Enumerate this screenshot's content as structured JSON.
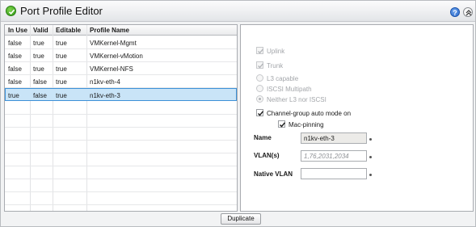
{
  "window": {
    "title": "Port Profile Editor"
  },
  "header_buttons": {
    "help_label": "?"
  },
  "table": {
    "columns": [
      "In Use",
      "Valid",
      "Editable",
      "Profile Name"
    ],
    "rows": [
      {
        "in_use": "false",
        "valid": "true",
        "editable": "true",
        "name": "VMKernel-Mgmt"
      },
      {
        "in_use": "false",
        "valid": "true",
        "editable": "true",
        "name": "VMKernel-vMotion"
      },
      {
        "in_use": "false",
        "valid": "true",
        "editable": "true",
        "name": "VMKernel-NFS"
      },
      {
        "in_use": "false",
        "valid": "false",
        "editable": "true",
        "name": "n1kv-eth-4"
      },
      {
        "in_use": "true",
        "valid": "false",
        "editable": "true",
        "name": "n1kv-eth-3"
      }
    ],
    "selected_row": 4
  },
  "form": {
    "uplink_label": "Uplink",
    "trunk_label": "Trunk",
    "l3_label": "L3 capable",
    "iscsi_label": "ISCSI Multipath",
    "neither_label": "Neither L3 nor ISCSI",
    "channel_group_label": "Channel-group auto mode on",
    "mac_pinning_label": "Mac-pinning",
    "name_label": "Name",
    "name_value": "n1kv-eth-3",
    "vlans_label": "VLAN(s)",
    "vlans_placeholder": "1,76,2031,2034",
    "native_vlan_label": "Native VLAN",
    "native_vlan_value": ""
  },
  "actions": {
    "duplicate_label": "Duplicate"
  },
  "colors": {
    "selection": "#c9e4f7",
    "selection_border": "#3d91d8",
    "accent_green": "#2f9a16"
  }
}
